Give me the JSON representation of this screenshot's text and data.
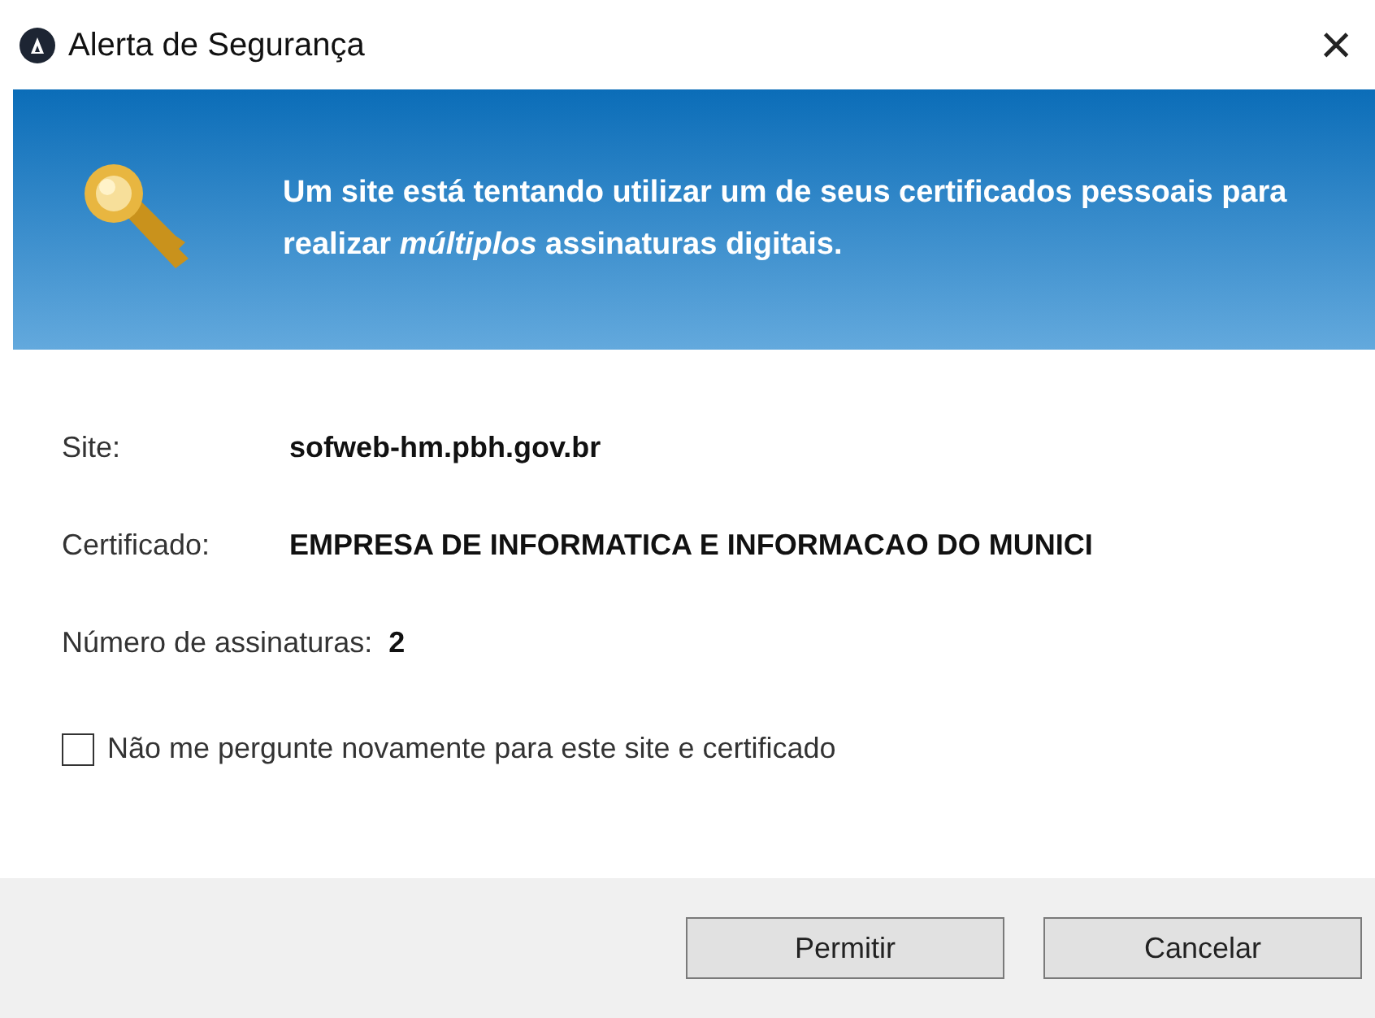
{
  "window": {
    "title": "Alerta de Segurança",
    "close": "×"
  },
  "banner": {
    "message": "Um site está tentando utilizar um de seus certificados pessoais para realizar *múltiplos* assinaturas digitais."
  },
  "fields": [
    {
      "label": "Site:",
      "value": "sofweb-hm.pbh.gov.br"
    },
    {
      "label": "Certificado:",
      "value": "EMPRESA DE INFORMATICA E INFORMACAO DO MUNICI"
    },
    {
      "label": "Número de assinaturas:",
      "value": "2"
    }
  ],
  "checkbox": {
    "label": "Não me pergunte novamente para este site e certificado",
    "checked": false
  },
  "buttons": [
    "Permitir",
    "Cancelar"
  ]
}
